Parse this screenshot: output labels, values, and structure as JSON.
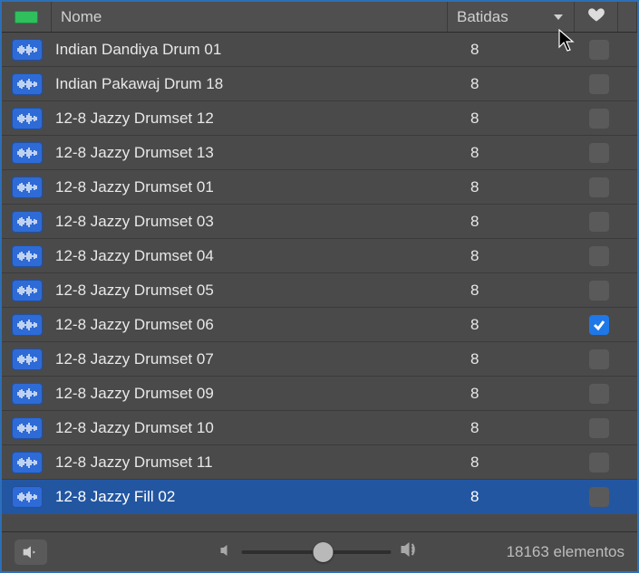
{
  "columns": {
    "name_label": "Nome",
    "beats_label": "Batidas"
  },
  "rows": [
    {
      "name": "Indian Dandiya Drum 01",
      "beats": "8",
      "fav": false,
      "selected": false
    },
    {
      "name": "Indian Pakawaj Drum 18",
      "beats": "8",
      "fav": false,
      "selected": false
    },
    {
      "name": "12-8 Jazzy Drumset 12",
      "beats": "8",
      "fav": false,
      "selected": false
    },
    {
      "name": "12-8 Jazzy Drumset 13",
      "beats": "8",
      "fav": false,
      "selected": false
    },
    {
      "name": "12-8 Jazzy Drumset 01",
      "beats": "8",
      "fav": false,
      "selected": false
    },
    {
      "name": "12-8 Jazzy Drumset 03",
      "beats": "8",
      "fav": false,
      "selected": false
    },
    {
      "name": "12-8 Jazzy Drumset 04",
      "beats": "8",
      "fav": false,
      "selected": false
    },
    {
      "name": "12-8 Jazzy Drumset 05",
      "beats": "8",
      "fav": false,
      "selected": false
    },
    {
      "name": "12-8 Jazzy Drumset 06",
      "beats": "8",
      "fav": true,
      "selected": false
    },
    {
      "name": "12-8 Jazzy Drumset 07",
      "beats": "8",
      "fav": false,
      "selected": false
    },
    {
      "name": "12-8 Jazzy Drumset 09",
      "beats": "8",
      "fav": false,
      "selected": false
    },
    {
      "name": "12-8 Jazzy Drumset 10",
      "beats": "8",
      "fav": false,
      "selected": false
    },
    {
      "name": "12-8 Jazzy Drumset 11",
      "beats": "8",
      "fav": false,
      "selected": false
    },
    {
      "name": "12-8 Jazzy Fill 02",
      "beats": "8",
      "fav": false,
      "selected": true
    }
  ],
  "footer": {
    "status": "18163 elementos"
  }
}
